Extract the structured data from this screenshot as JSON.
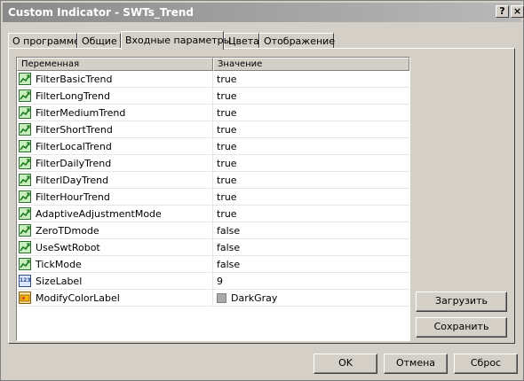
{
  "window": {
    "title": "Custom Indicator - SWTs_Trend",
    "help_label": "?",
    "close_label": "×"
  },
  "tabs": [
    {
      "label": "О программе"
    },
    {
      "label": "Общие"
    },
    {
      "label": "Входные параметры",
      "active": true
    },
    {
      "label": "Цвета"
    },
    {
      "label": "Отображение"
    }
  ],
  "grid": {
    "headers": {
      "variable": "Переменная",
      "value": "Значение"
    },
    "rows": [
      {
        "name": "FilterBasicTrend",
        "value": "true",
        "icon": "bool-icon"
      },
      {
        "name": "FilterLongTrend",
        "value": "true",
        "icon": "bool-icon"
      },
      {
        "name": "FilterMediumTrend",
        "value": "true",
        "icon": "bool-icon"
      },
      {
        "name": "FilterShortTrend",
        "value": "true",
        "icon": "bool-icon"
      },
      {
        "name": "FilterLocalTrend",
        "value": "true",
        "icon": "bool-icon"
      },
      {
        "name": "FilterDailyTrend",
        "value": "true",
        "icon": "bool-icon"
      },
      {
        "name": "FilterlDayTrend",
        "value": "true",
        "icon": "bool-icon"
      },
      {
        "name": "FilterHourTrend",
        "value": "true",
        "icon": "bool-icon"
      },
      {
        "name": "AdaptiveAdjustmentMode",
        "value": "true",
        "icon": "bool-icon"
      },
      {
        "name": "ZeroTDmode",
        "value": "false",
        "icon": "bool-icon"
      },
      {
        "name": "UseSwtRobot",
        "value": "false",
        "icon": "bool-icon"
      },
      {
        "name": "TickMode",
        "value": "false",
        "icon": "bool-icon"
      },
      {
        "name": "SizeLabel",
        "value": "9",
        "icon": "integer-icon",
        "icon_text": "123"
      },
      {
        "name": "ModifyColorLabel",
        "value": "DarkGray",
        "icon": "color-icon",
        "swatch_color": "#a9a9a9"
      }
    ]
  },
  "side_buttons": {
    "load": "Загрузить",
    "save": "Сохранить"
  },
  "footer_buttons": {
    "ok": "OK",
    "cancel": "Отмена",
    "reset": "Сброс"
  },
  "colors": {
    "titlebar": "#9a9a9a",
    "face": "#d4d0c8",
    "grid_bg": "#ffffff"
  }
}
